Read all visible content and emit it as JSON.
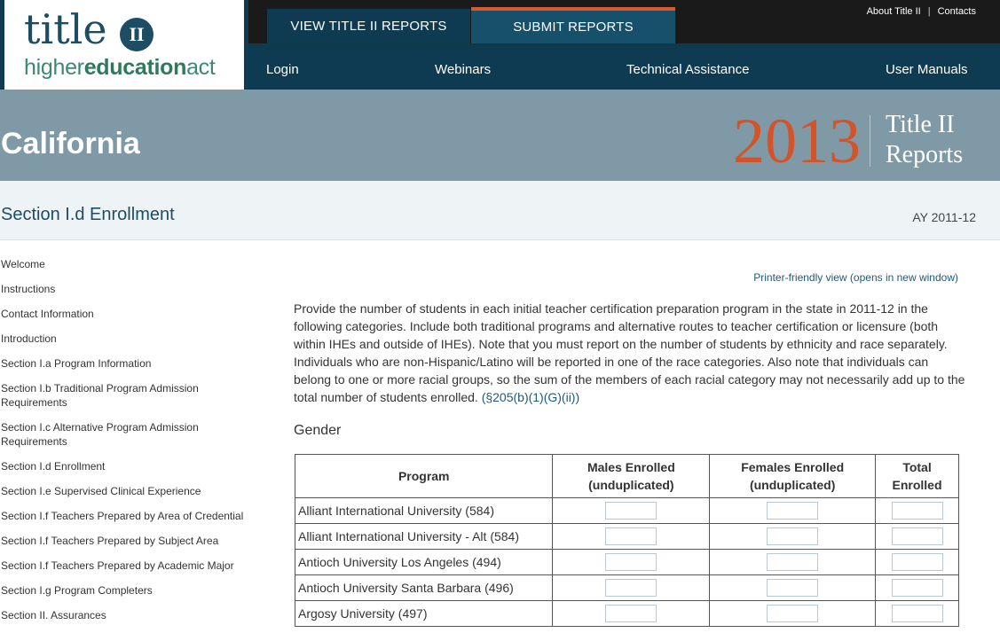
{
  "logo": {
    "title_word": "title",
    "numeral": "II",
    "tagline_light": "higher",
    "tagline_bold": "education",
    "tagline_end": "act"
  },
  "top_tabs": [
    {
      "label": "VIEW TITLE II REPORTS"
    },
    {
      "label": "SUBMIT REPORTS"
    }
  ],
  "top_links": [
    {
      "label": "About Title II"
    },
    {
      "label": "Contacts"
    }
  ],
  "secondary_nav": [
    {
      "label": "Login"
    },
    {
      "label": "Webinars"
    },
    {
      "label": "Technical Assistance"
    },
    {
      "label": "User Manuals"
    }
  ],
  "banner": {
    "state": "California",
    "year": "2013",
    "report_line1": "Title II",
    "report_line2": "Reports"
  },
  "section": {
    "title": "Section I.d Enrollment",
    "academic_year": "AY 2011-12"
  },
  "sidebar": {
    "items": [
      {
        "label": "Welcome"
      },
      {
        "label": "Instructions"
      },
      {
        "label": "Contact Information"
      },
      {
        "label": "Introduction"
      },
      {
        "label": "Section I.a Program Information"
      },
      {
        "label": "Section I.b Traditional Program Admission Requirements"
      },
      {
        "label": "Section I.c Alternative Program Admission Requirements"
      },
      {
        "label": "Section I.d Enrollment"
      },
      {
        "label": "Section I.e Supervised Clinical Experience"
      },
      {
        "label": "Section I.f Teachers Prepared by Area of Credential"
      },
      {
        "label": "Section I.f Teachers Prepared by Subject Area"
      },
      {
        "label": "Section I.f Teachers Prepared by Academic Major"
      },
      {
        "label": "Section I.g Program Completers"
      },
      {
        "label": "Section II. Assurances"
      }
    ]
  },
  "main": {
    "printer_link": "Printer-friendly view (opens in new window)",
    "intro_text": "Provide the number of students in each initial teacher certification preparation program in the state in 2011-12 in the following categories. Include both traditional programs and alternative routes to teacher certification or licensure (both within IHEs and outside of IHEs). Note that you must report on the number of students by ethnicity and race separately. Individuals who are non-Hispanic/Latino will be reported in one of the race categories. Also note that individuals can belong to one or more racial groups, so the sum of the members of each racial category may not necessarily add up to the total number of students enrolled.",
    "citation": "(§205(b)(1)(G)(ii))",
    "gender_heading": "Gender",
    "table": {
      "headers": {
        "program": "Program",
        "males": "Males Enrolled (unduplicated)",
        "females": "Females Enrolled (unduplicated)",
        "total": "Total Enrolled"
      },
      "rows": [
        {
          "program": "Alliant International University (584)",
          "males": "",
          "females": "",
          "total": ""
        },
        {
          "program": "Alliant International University - Alt (584)",
          "males": "",
          "females": "",
          "total": ""
        },
        {
          "program": "Antioch University Los Angeles (494)",
          "males": "",
          "females": "",
          "total": ""
        },
        {
          "program": "Antioch University Santa Barbara (496)",
          "males": "",
          "females": "",
          "total": ""
        },
        {
          "program": "Argosy University (497)",
          "males": "",
          "females": "",
          "total": ""
        }
      ]
    }
  }
}
